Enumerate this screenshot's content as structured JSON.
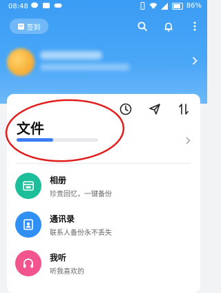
{
  "statusbar": {
    "time": "08:48",
    "battery": "86%"
  },
  "header": {
    "checkin_label": "签到"
  },
  "files": {
    "title": "文件",
    "progress": 0.45
  },
  "list": [
    {
      "title": "相册",
      "subtitle": "珍贵回忆，一键备份",
      "icon": "album-icon",
      "color": "#1dbf9b"
    },
    {
      "title": "通讯录",
      "subtitle": "联系人备份永不丢失",
      "icon": "contacts-icon",
      "color": "#2f8ff2"
    },
    {
      "title": "我听",
      "subtitle": "听我喜欢的",
      "icon": "headphones-icon",
      "color": "#f2558d"
    }
  ],
  "colors": {
    "header": "#3a9cf4",
    "accent": "#3b7cf2",
    "annotation": "#e21b1b"
  }
}
